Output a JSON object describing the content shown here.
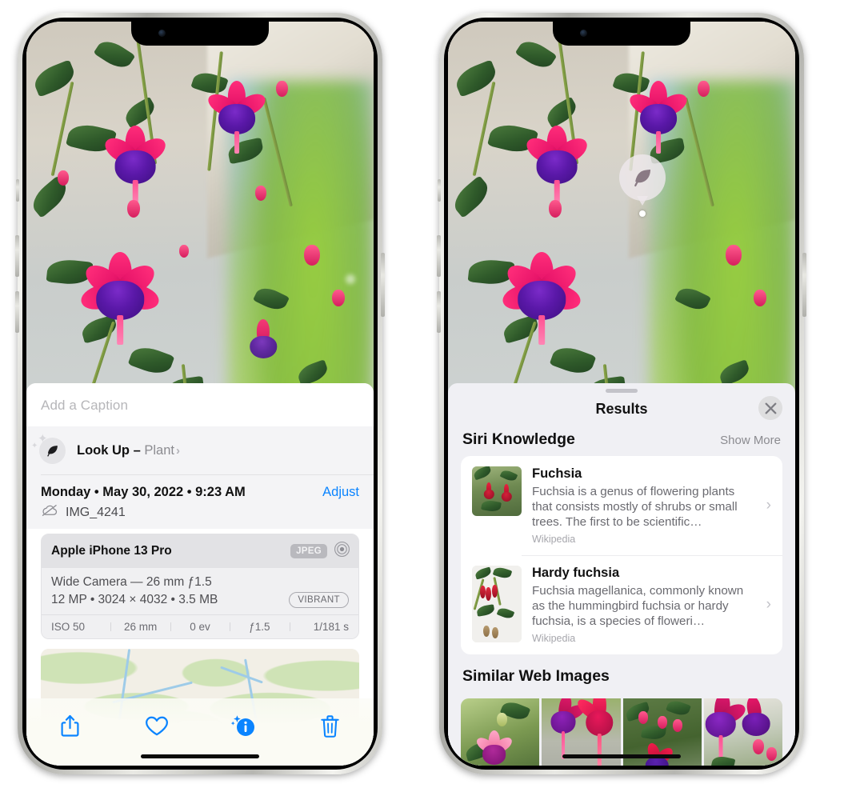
{
  "left_phone": {
    "caption_placeholder": "Add a Caption",
    "lookup": {
      "label": "Look Up – ",
      "subject": "Plant",
      "chevron": "›",
      "icon": "leaf-icon"
    },
    "meta": {
      "date": "Monday • May 30, 2022 • 9:23 AM",
      "adjust_label": "Adjust",
      "filename": "IMG_4241",
      "cloud_icon": "icloud-slash-icon"
    },
    "exif": {
      "model": "Apple iPhone 13 Pro",
      "format_badge": "JPEG",
      "aperture_icon": "aperture-icon",
      "lens_line": "Wide Camera — 26 mm ƒ1.5",
      "size_line": "12 MP • 3024 × 4032 • 3.5 MB",
      "style_badge": "VIBRANT",
      "stats": [
        "ISO 50",
        "26 mm",
        "0 ev",
        "ƒ1.5",
        "1/181 s"
      ]
    },
    "toolbar": [
      {
        "name": "share-button",
        "icon": "share-icon"
      },
      {
        "name": "favorite-button",
        "icon": "heart-icon"
      },
      {
        "name": "info-button",
        "icon": "info-sparkle-icon"
      },
      {
        "name": "delete-button",
        "icon": "trash-icon"
      }
    ]
  },
  "right_phone": {
    "visual_lookup_badge": {
      "icon": "leaf-icon"
    },
    "sheet": {
      "title": "Results",
      "close_icon": "close-icon"
    },
    "siri_knowledge": {
      "heading": "Siri Knowledge",
      "action": "Show More",
      "results": [
        {
          "title": "Fuchsia",
          "description": "Fuchsia is a genus of flowering plants that consists mostly of shrubs or small trees. The first to be scientific…",
          "source": "Wikipedia",
          "chevron": "›"
        },
        {
          "title": "Hardy fuchsia",
          "description": "Fuchsia magellanica, commonly known as the hummingbird fuchsia or hardy fuchsia, is a species of floweri…",
          "source": "Wikipedia",
          "chevron": "›"
        }
      ]
    },
    "similar_web_images": {
      "heading": "Similar Web Images",
      "count": 4
    }
  },
  "colors": {
    "accent_blue": "#0a84ff",
    "sheet_bg": "#f0f0f4",
    "card_bg": "#ffffff",
    "secondary_text": "#6a6a70"
  }
}
